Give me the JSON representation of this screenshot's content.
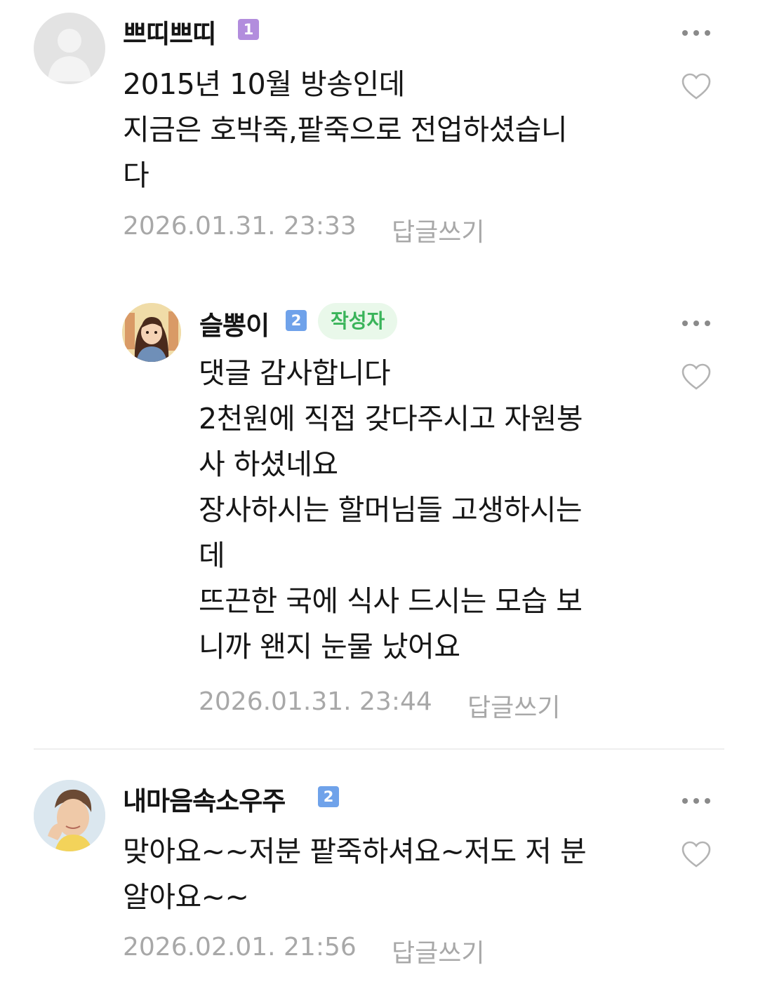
{
  "comments": [
    {
      "nickname": "쁘띠쁘띠",
      "level": "1",
      "text": "2015년 10월 방송인데\n지금은 호박죽,팥죽으로 전업하셨습니\n다",
      "date": "2026.01.31. 23:33",
      "reply_label": "답글쓰기"
    },
    {
      "nickname": "슬뽕이",
      "level": "2",
      "author_badge": "작성자",
      "text": "댓글 감사합니다\n2천원에 직접 갖다주시고 자원봉\n사 하셨네요\n장사하시는 할머님들 고생하시는\n데\n뜨끈한 국에 식사 드시는 모습 보\n니까 왠지 눈물 났어요",
      "date": "2026.01.31. 23:44",
      "reply_label": "답글쓰기"
    },
    {
      "nickname": "내마음속소우주",
      "level": "2",
      "text": "맞아요~~저분 팥죽하셔요~저도 저 분\n알아요~~",
      "date": "2026.02.01. 21:56",
      "reply_label": "답글쓰기"
    }
  ],
  "colors": {
    "level1_badge": "#b28ddd",
    "level2_badge": "#6fa2ea",
    "author_badge_bg": "#e9f8ea",
    "author_badge_text": "#3ab45a",
    "meta_text": "#a8a8a8"
  },
  "icons": [
    "default-avatar-icon",
    "more-options-icon",
    "heart-icon"
  ]
}
